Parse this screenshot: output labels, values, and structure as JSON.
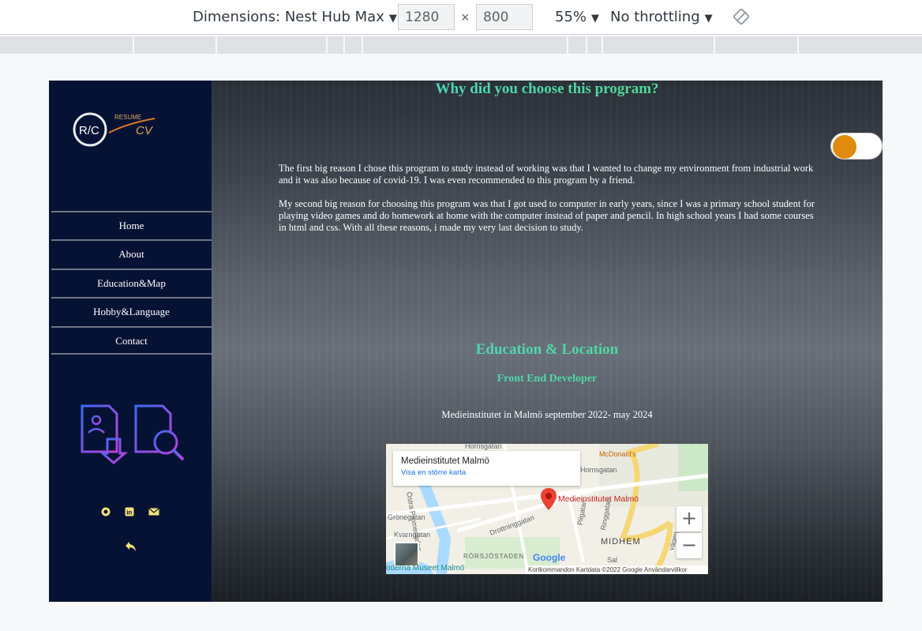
{
  "devtools": {
    "device_label": "Dimensions: Nest Hub Max",
    "width_value": "1280",
    "height_value": "800",
    "times": "×",
    "zoom_label": "55%",
    "throttle_label": "No throttling",
    "caret": "▼"
  },
  "sidebar": {
    "logo": {
      "initials": "R/C",
      "word1": "RESUME",
      "word2": "CV"
    },
    "nav": [
      "Home",
      "About",
      "Education&Map",
      "Hobby&Language",
      "Contact"
    ],
    "social_icons": [
      "github-icon",
      "linkedin-icon",
      "envelope-icon"
    ],
    "back_icon": "reply-arrow-icon"
  },
  "main": {
    "question_title": "Why did you choose this program?",
    "paragraph1": "The first big reason I chose this program to study instead of working was that I wanted to change my environment from industrial work and it was also because of covid-19. I was even recommended to this program by a friend.",
    "paragraph2": "My second big reason for choosing this program was that I got used to computer in early years, since I was a primary school student for playing video games and do homework at home with the computer instead of paper and pencil. In high school years I had some courses in html and css. With all these reasons, i made my very last decision to study.",
    "education_title": "Education & Location",
    "education_subtitle": "Front End Developer",
    "education_line": "Medieinstitutet in Malmö september 2022- may 2024"
  },
  "map": {
    "card_name": "Medieinstitutet Malmö",
    "card_link": "Visa en större karta",
    "pin_label": "Medieinstitutet Malmö",
    "zoom_in": "+",
    "zoom_out": "−",
    "streets": {
      "hornsgatan_top": "Hornsgatan",
      "hornsgatan": "Hornsgatan",
      "mcdonalds": "McDonald's",
      "ostra_promenaden": "Östra Promenaden",
      "gronegatan": "Grönegatan",
      "kvarngatan": "Kvarngatan",
      "drottninggatan": "Drottninggatan",
      "pilgatan": "Pilgatan",
      "ringgatan": "Ringgatan",
      "midhem": "MIDHEM",
      "rorsjostaden": "RÖRSJÖSTADEN",
      "vagen": "vägen",
      "sal": "Sal"
    },
    "google": "Google",
    "footer": "Kortkommandon    Kartdata ©2022 Google    Användarvillkor",
    "moderna": "oderna Museet Malmö"
  }
}
